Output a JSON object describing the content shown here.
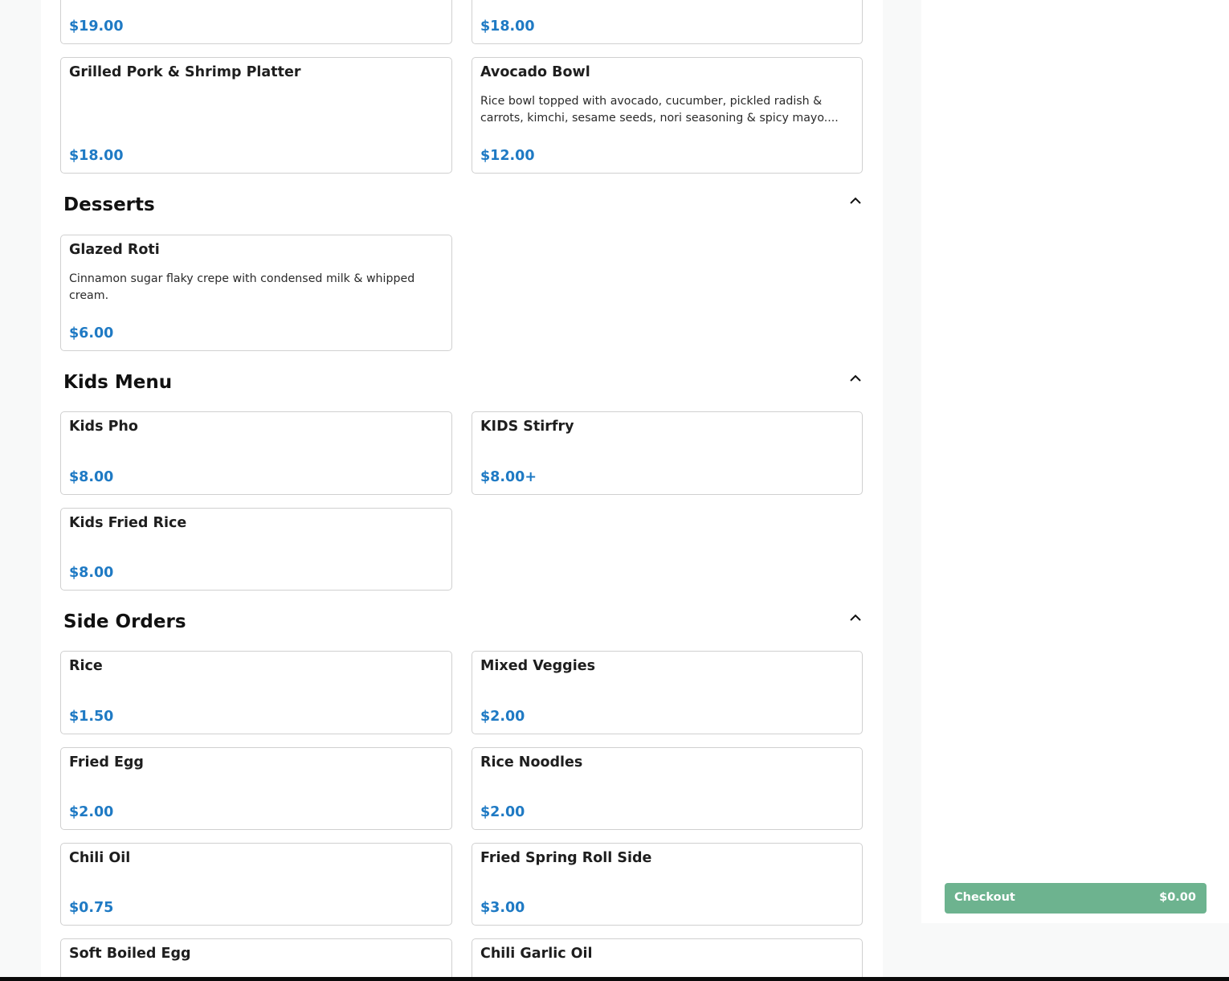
{
  "sections": {
    "entrees": {
      "items": [
        {
          "price": "$19.00"
        },
        {
          "price": "$18.00"
        },
        {
          "name": "Grilled Pork & Shrimp Platter",
          "price": "$18.00"
        },
        {
          "name": "Avocado Bowl",
          "description": "Rice bowl topped with avocado, cucumber, pickled radish & carrots, kimchi, sesame seeds, nori seasoning & spicy mayo....",
          "price": "$12.00"
        }
      ]
    },
    "desserts": {
      "title": "Desserts",
      "items": [
        {
          "name": "Glazed Roti",
          "description": "Cinnamon sugar flaky crepe with condensed milk & whipped cream.",
          "price": "$6.00"
        }
      ]
    },
    "kids": {
      "title": "Kids Menu",
      "items": [
        {
          "name": "Kids Pho",
          "price": "$8.00"
        },
        {
          "name": "KIDS Stirfry",
          "price": "$8.00+"
        },
        {
          "name": "Kids Fried Rice",
          "price": "$8.00"
        }
      ]
    },
    "sides": {
      "title": "Side Orders",
      "items": [
        {
          "name": "Rice",
          "price": "$1.50"
        },
        {
          "name": "Mixed Veggies",
          "price": "$2.00"
        },
        {
          "name": "Fried Egg",
          "price": "$2.00"
        },
        {
          "name": "Rice Noodles",
          "price": "$2.00"
        },
        {
          "name": "Chili Oil",
          "price": "$0.75"
        },
        {
          "name": "Fried Spring Roll Side",
          "price": "$3.00"
        },
        {
          "name": "Soft Boiled Egg"
        },
        {
          "name": "Chili Garlic Oil"
        }
      ]
    }
  },
  "cart": {
    "checkout_label": "Checkout",
    "total": "$0.00"
  },
  "icons": {
    "collapse": "chevron-up-icon"
  },
  "colors": {
    "price": "#1f7ac4",
    "checkout_button": "#6db38f",
    "card_border": "#d0d0d0",
    "page_background": "#f8f9f9"
  }
}
